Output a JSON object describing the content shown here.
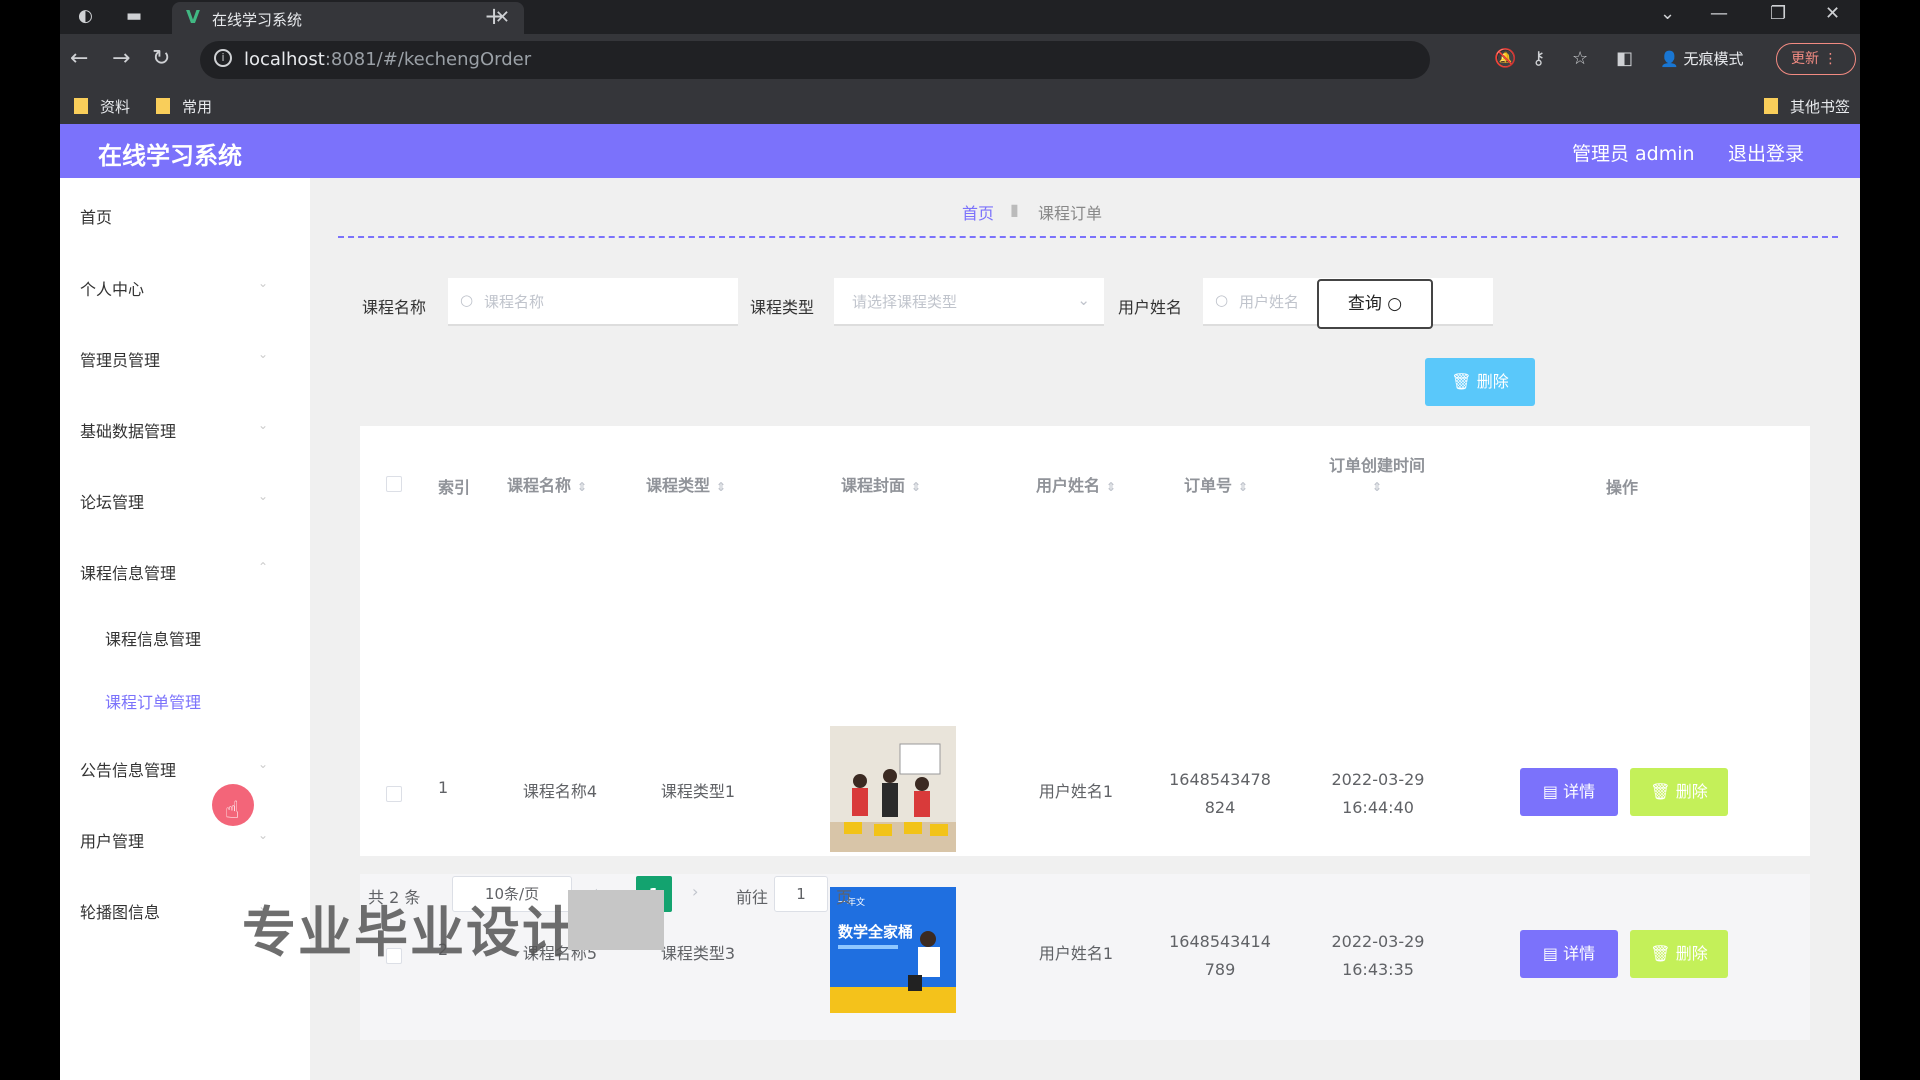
{
  "browser": {
    "tab_title": "在线学习系统",
    "url_host": "localhost",
    "url_rest": ":8081/#/kechengOrder",
    "incognito_label": "无痕模式",
    "update_label": "更新",
    "bookmarks": [
      "资料",
      "常用"
    ],
    "other_bookmarks": "其他书签"
  },
  "header": {
    "title": "在线学习系统",
    "admin": "管理员 admin",
    "logout": "退出登录"
  },
  "sidebar": {
    "items": [
      "首页",
      "个人中心",
      "管理员管理",
      "基础数据管理",
      "论坛管理",
      "课程信息管理",
      "公告信息管理",
      "用户管理",
      "轮播图信息"
    ],
    "sub_items": [
      "课程信息管理",
      "课程订单管理"
    ]
  },
  "breadcrumb": {
    "home": "首页",
    "current": "课程订单"
  },
  "search": {
    "course_name_label": "课程名称",
    "course_name_placeholder": "课程名称",
    "course_type_label": "课程类型",
    "course_type_placeholder": "请选择课程类型",
    "user_name_label": "用户姓名",
    "user_name_placeholder": "用户姓名",
    "query_button": "查询"
  },
  "toolbar": {
    "delete_label": "删除"
  },
  "table": {
    "headers": [
      "索引",
      "课程名称",
      "课程类型",
      "课程封面",
      "用户姓名",
      "订单号",
      "订单创建时间",
      "操作"
    ],
    "rows": [
      {
        "index": "1",
        "course_name": "课程名称4",
        "course_type": "课程类型1",
        "user_name": "用户姓名1",
        "order_no_1": "1648543478",
        "order_no_2": "824",
        "date": "2022-03-29",
        "time": "16:44:40",
        "detail": "详情",
        "delete": "删除"
      },
      {
        "index": "2",
        "course_name": "课程名称5",
        "course_type": "课程类型3",
        "user_name": "用户姓名1",
        "order_no_1": "1648543414",
        "order_no_2": "789",
        "date": "2022-03-29",
        "time": "16:43:35",
        "detail": "详情",
        "delete": "删除"
      }
    ],
    "cover2_text_top": "一年文",
    "cover2_text_main": "数学全家桶"
  },
  "pagination": {
    "total": "共 2 条",
    "page_size": "10条/页",
    "current_page": "1",
    "goto_label": "前往",
    "goto_value": "1",
    "page_unit": "页"
  },
  "overlay": {
    "watermark": "专业毕业设计"
  },
  "colors": {
    "primary": "#7b72fb",
    "delete_top": "#5ac8fa",
    "delete_row": "#c4f059",
    "page_active": "#13a36f"
  }
}
